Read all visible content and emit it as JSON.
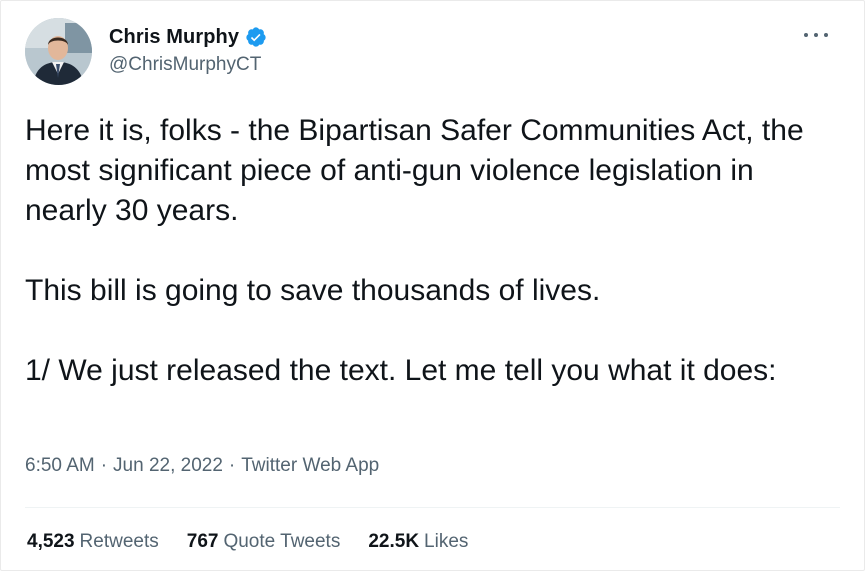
{
  "author": {
    "display_name": "Chris Murphy",
    "handle": "@ChrisMurphyCT",
    "verified_icon": "verified-badge-icon",
    "avatar_icon": "avatar-photo"
  },
  "menu": {
    "icon": "more-options-icon"
  },
  "tweet": {
    "paragraphs": [
      "Here it is, folks - the Bipartisan Safer Communities Act, the most significant piece of anti-gun violence legislation in nearly 30 years.",
      "This bill is going to save thousands of lives.",
      "1/ We just released the text. Let me tell you what it does:"
    ]
  },
  "meta": {
    "time": "6:50 AM",
    "separator": "·",
    "date": "Jun 22, 2022",
    "source": "Twitter Web App"
  },
  "stats": {
    "retweets_count": "4,523",
    "retweets_label": "Retweets",
    "quotes_count": "767",
    "quotes_label": "Quote Tweets",
    "likes_count": "22.5K",
    "likes_label": "Likes"
  },
  "colors": {
    "text_primary": "#0f1419",
    "text_secondary": "#536471",
    "verified_blue": "#1d9bf0",
    "divider": "#eff3f4"
  }
}
